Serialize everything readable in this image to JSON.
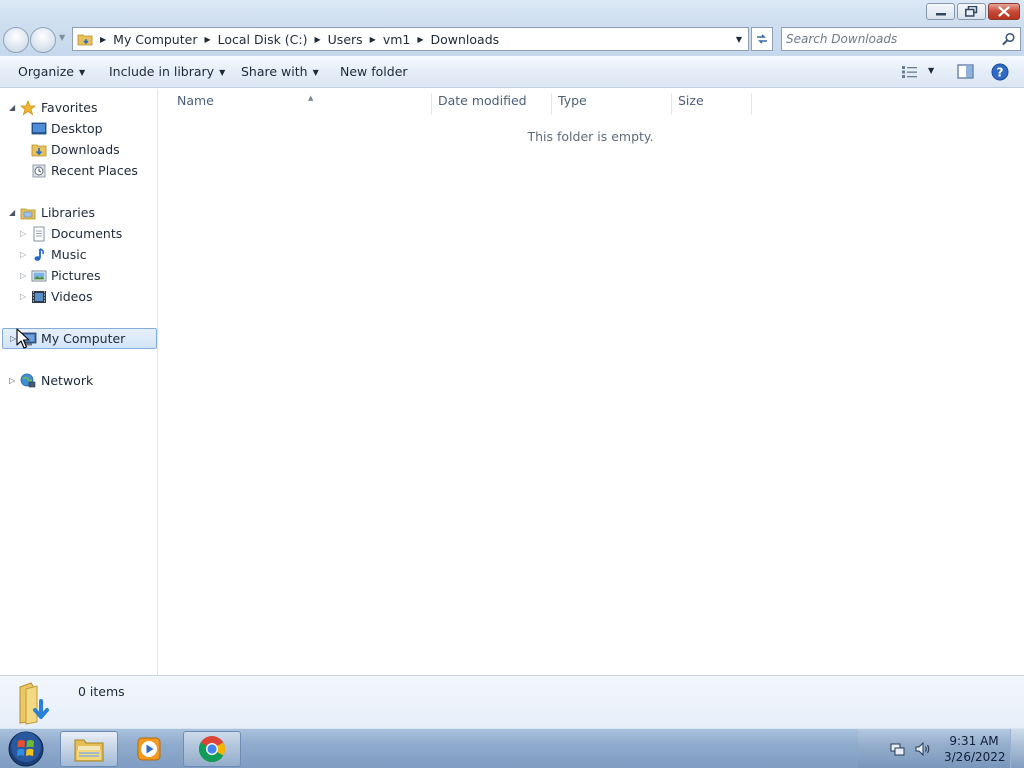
{
  "window": {
    "buttons": {
      "minimize": "minimize-icon",
      "maximize": "restore-icon",
      "close": "close-icon"
    }
  },
  "address": {
    "breadcrumbs": [
      "My Computer",
      "Local Disk (C:)",
      "Users",
      "vm1",
      "Downloads"
    ],
    "search_placeholder": "Search Downloads"
  },
  "toolbar": {
    "organize": "Organize",
    "include_in_library": "Include in library",
    "share_with": "Share with",
    "new_folder": "New folder"
  },
  "nav": {
    "favorites": {
      "label": "Favorites",
      "items": [
        {
          "label": "Desktop",
          "icon": "desktop-icon"
        },
        {
          "label": "Downloads",
          "icon": "downloads-folder-icon"
        },
        {
          "label": "Recent Places",
          "icon": "recent-places-icon"
        }
      ]
    },
    "libraries": {
      "label": "Libraries",
      "items": [
        {
          "label": "Documents",
          "icon": "documents-icon"
        },
        {
          "label": "Music",
          "icon": "music-icon"
        },
        {
          "label": "Pictures",
          "icon": "pictures-icon"
        },
        {
          "label": "Videos",
          "icon": "videos-icon"
        }
      ]
    },
    "my_computer": {
      "label": "My Computer",
      "selected": true
    },
    "network": {
      "label": "Network"
    }
  },
  "content": {
    "columns": [
      "Name",
      "Date modified",
      "Type",
      "Size"
    ],
    "sorted_column": "Name",
    "empty_message": "This folder is empty."
  },
  "details": {
    "item_count": "0 items"
  },
  "taskbar": {
    "apps": [
      "windows-explorer-icon",
      "media-player-icon",
      "chrome-icon"
    ],
    "clock": {
      "time": "9:31 AM",
      "date": "3/26/2022"
    }
  },
  "colors": {
    "selection_border": "#84acdd",
    "selection_fill": "#d2e4f8",
    "header_text": "#4c607a",
    "close_button": "#c64a37"
  }
}
